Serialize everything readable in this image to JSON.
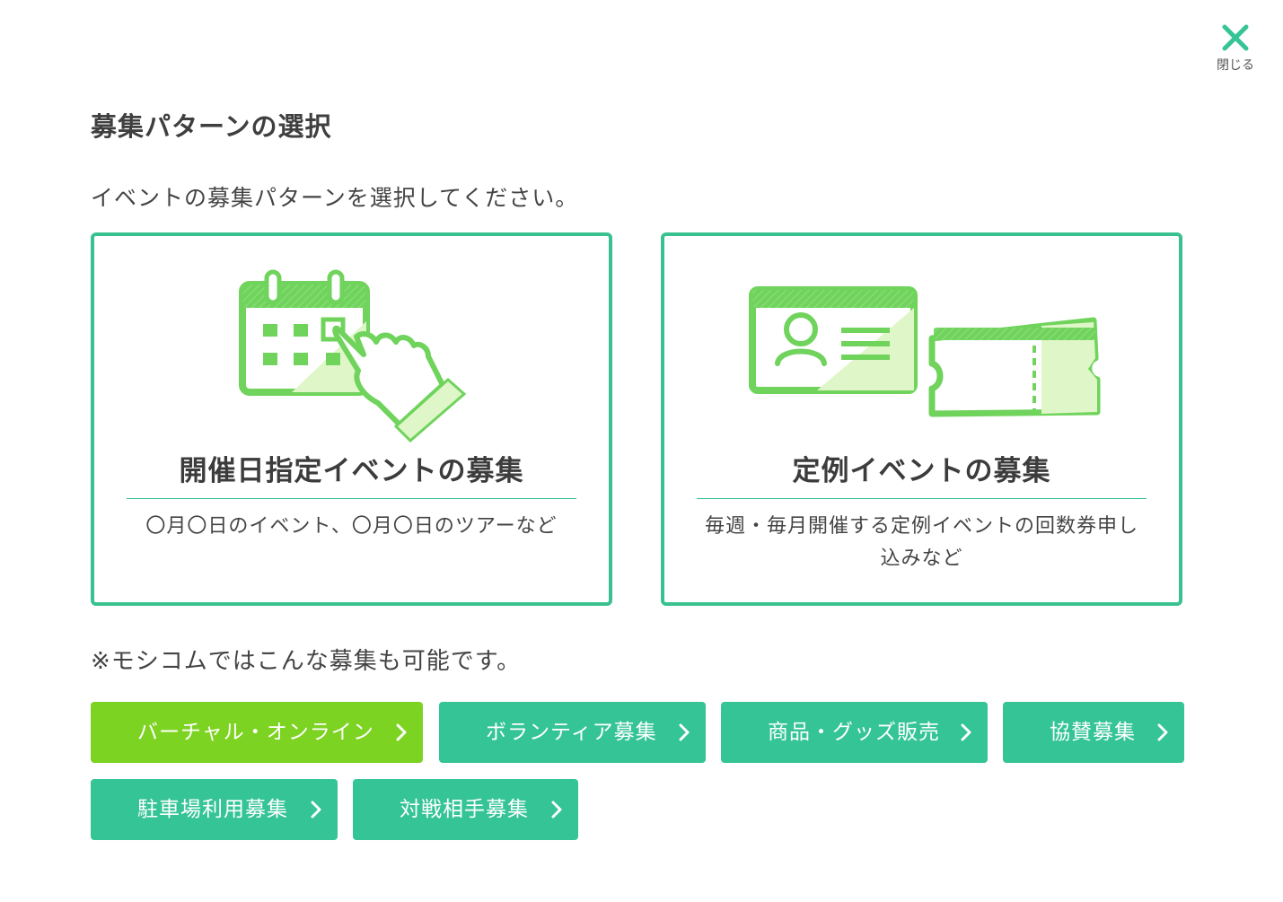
{
  "close": {
    "label": "閉じる"
  },
  "title": "募集パターンの選択",
  "lead": "イベントの募集パターンを選択してください。",
  "cards": [
    {
      "title": "開催日指定イベントの募集",
      "description": "〇月〇日のイベント、〇月〇日のツアーなど",
      "icon": "calendar-hand-icon"
    },
    {
      "title": "定例イベントの募集",
      "description": "毎週・毎月開催する定例イベントの回数券申し込みなど",
      "icon": "membership-card-ticket-icon"
    }
  ],
  "note": "※モシコムではこんな募集も可能です。",
  "options": [
    {
      "label": "バーチャル・オンライン"
    },
    {
      "label": "ボランティア募集"
    },
    {
      "label": "商品・グッズ販売"
    },
    {
      "label": "協賛募集"
    },
    {
      "label": "駐車場利用募集"
    },
    {
      "label": "対戦相手募集"
    }
  ],
  "colors": {
    "accent": "#3ac190",
    "button": "#35c496",
    "button_highlight": "#7dd321",
    "illustration": "#6fd35c",
    "illustration_fill": "#dff7c8"
  }
}
